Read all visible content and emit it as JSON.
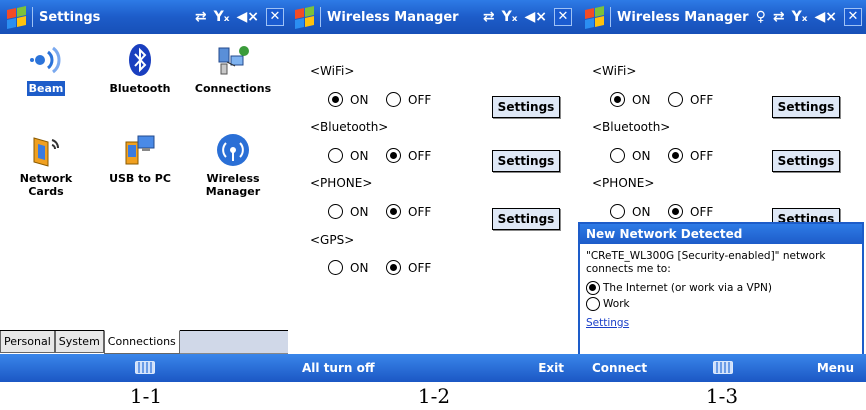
{
  "panels": [
    {
      "title": "Settings",
      "apps": [
        {
          "label": "Beam",
          "icon": "beam-icon",
          "selected": true
        },
        {
          "label": "Bluetooth",
          "icon": "bluetooth-icon"
        },
        {
          "label": "Connections",
          "icon": "connections-icon"
        },
        {
          "label": "Network Cards",
          "icon": "network-cards-icon"
        },
        {
          "label": "USB to PC",
          "icon": "usb-to-pc-icon"
        },
        {
          "label": "Wireless Manager",
          "icon": "wireless-manager-icon"
        }
      ],
      "tabs": [
        "Personal",
        "System",
        "Connections"
      ],
      "active_tab": "Connections",
      "caption": "1-1"
    },
    {
      "title": "Wireless Manager",
      "groups": [
        {
          "heading": "<WiFi>",
          "on_label": "ON",
          "off_label": "OFF",
          "state": "on",
          "button": "Settings"
        },
        {
          "heading": "<Bluetooth>",
          "on_label": "ON",
          "off_label": "OFF",
          "state": "off",
          "button": "Settings"
        },
        {
          "heading": "<PHONE>",
          "on_label": "ON",
          "off_label": "OFF",
          "state": "off",
          "button": "Settings"
        },
        {
          "heading": "<GPS>",
          "on_label": "ON",
          "off_label": "OFF",
          "state": "off"
        }
      ],
      "softkeys": {
        "left": "All turn off",
        "right": "Exit"
      },
      "caption": "1-2"
    },
    {
      "title": "Wireless Manager",
      "groups": [
        {
          "heading": "<WiFi>",
          "on_label": "ON",
          "off_label": "OFF",
          "state": "on",
          "button": "Settings"
        },
        {
          "heading": "<Bluetooth>",
          "on_label": "ON",
          "off_label": "OFF",
          "state": "off",
          "button": "Settings"
        },
        {
          "heading": "<PHONE>",
          "on_label": "ON",
          "off_label": "OFF",
          "state": "off",
          "button": "Settings"
        }
      ],
      "notification": {
        "title": "New Network Detected",
        "message": "\"CReTE_WL300G [Security-enabled]\" network connects me to:",
        "options": [
          "The Internet (or work via a VPN)",
          "Work"
        ],
        "selected": 0,
        "link": "Settings"
      },
      "softkeys": {
        "left": "Connect",
        "right": "Menu"
      },
      "caption": "1-3"
    }
  ],
  "colors": {
    "titlebar": "#1d5cc9",
    "accent": "#2e7be6"
  }
}
